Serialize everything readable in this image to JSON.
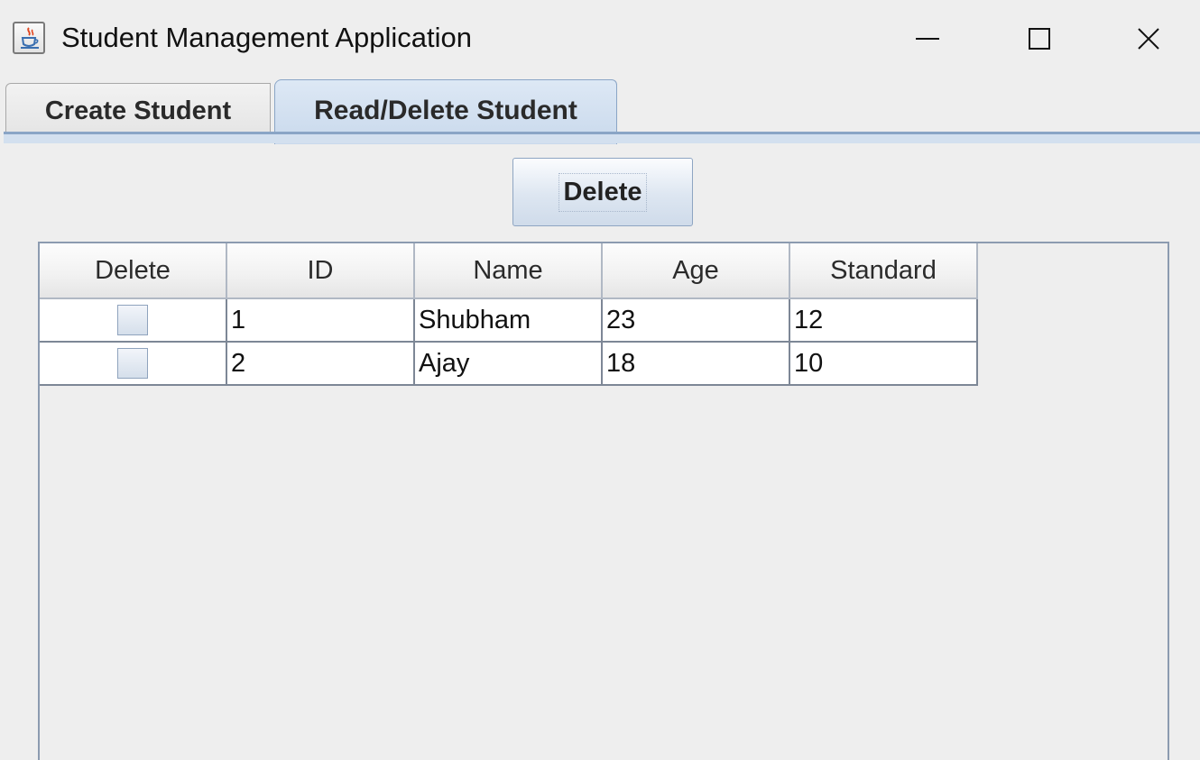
{
  "window": {
    "title": "Student Management Application",
    "icon": "java-cup-icon",
    "controls": [
      "minimize-icon",
      "maximize-icon",
      "close-icon"
    ]
  },
  "tabs": [
    {
      "label": "Create Student",
      "selected": false
    },
    {
      "label": "Read/Delete Student",
      "selected": true
    }
  ],
  "toolbar": {
    "delete_label": "Delete"
  },
  "table": {
    "columns": [
      "Delete",
      "ID",
      "Name",
      "Age",
      "Standard"
    ],
    "rows": [
      {
        "delete": false,
        "id": "1",
        "name": "Shubham",
        "age": "23",
        "standard": "12"
      },
      {
        "delete": false,
        "id": "2",
        "name": "Ajay",
        "age": "18",
        "standard": "10"
      }
    ]
  },
  "colors": {
    "background": "#eeeeee",
    "selected_tab": "#c9d9ec",
    "tab_border": "#8aa5c6",
    "grid_line": "#7d8796"
  }
}
